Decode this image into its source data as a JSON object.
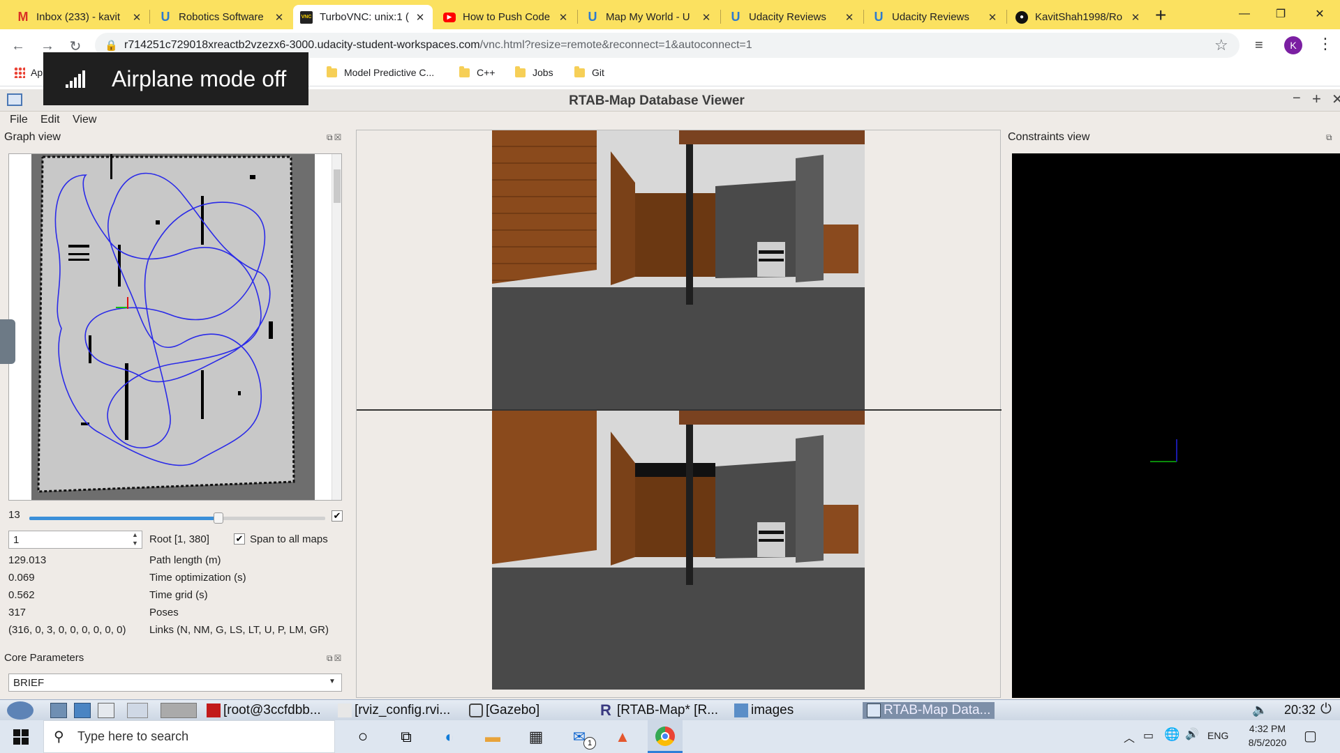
{
  "browser": {
    "tabs": [
      {
        "title": "Inbox (233) - kavit",
        "icon": "gmail-icon"
      },
      {
        "title": "Robotics Software",
        "icon": "udacity-icon"
      },
      {
        "title": "TurboVNC: unix:1 (",
        "icon": "vnc-icon"
      },
      {
        "title": "How to Push Code",
        "icon": "youtube-icon"
      },
      {
        "title": "Map My World - U",
        "icon": "udacity-icon"
      },
      {
        "title": "Udacity Reviews",
        "icon": "udacity-icon"
      },
      {
        "title": "Udacity Reviews",
        "icon": "udacity-icon"
      },
      {
        "title": "KavitShah1998/Ro",
        "icon": "github-icon"
      }
    ],
    "url_host": "r714251c729018xreactb2vzezx6-3000.udacity-student-workspaces.com",
    "url_path": "/vnc.html?resize=remote&reconnect=1&autoconnect=1",
    "profile_initial": "K",
    "bookmarks": [
      {
        "label": "Ap"
      },
      {
        "label": "Model Predictive C..."
      },
      {
        "label": "C++"
      },
      {
        "label": "Jobs"
      },
      {
        "label": "Git"
      }
    ]
  },
  "toast": {
    "text": "Airplane mode off"
  },
  "rtab": {
    "title": "RTAB-Map Database Viewer",
    "menus": [
      "File",
      "Edit",
      "View"
    ],
    "graph_view_title": "Graph view",
    "constraints_view_title": "Constraints view",
    "slider_value": "13",
    "slider_fraction": 0.64,
    "root_spin": "1",
    "root_label": "Root [1, 380]",
    "span_label": "Span to all maps",
    "stats": [
      {
        "value": "129.013",
        "label": "Path length (m)"
      },
      {
        "value": "0.069",
        "label": "Time optimization (s)"
      },
      {
        "value": "0.562",
        "label": "Time grid (s)"
      },
      {
        "value": "317",
        "label": "Poses"
      },
      {
        "value": "(316, 0, 3, 0, 0, 0, 0, 0, 0)",
        "label": "Links (N, NM, G, LS, LT, U, P, LM, GR)"
      }
    ],
    "core_params_title": "Core Parameters",
    "core_params_value": "BRIEF"
  },
  "vnc_taskbar": {
    "items": [
      {
        "label": "[root@3ccfdbb..."
      },
      {
        "label": "[rviz_config.rvi..."
      },
      {
        "label": "[Gazebo]"
      },
      {
        "label": "[RTAB-Map* [R..."
      },
      {
        "label": "images"
      },
      {
        "label": "RTAB-Map Data..."
      }
    ],
    "clock": "20:32"
  },
  "windows": {
    "search_placeholder": "Type here to search",
    "lang": "ENG",
    "time": "4:32 PM",
    "date": "8/5/2020",
    "mail_badge": "1"
  }
}
